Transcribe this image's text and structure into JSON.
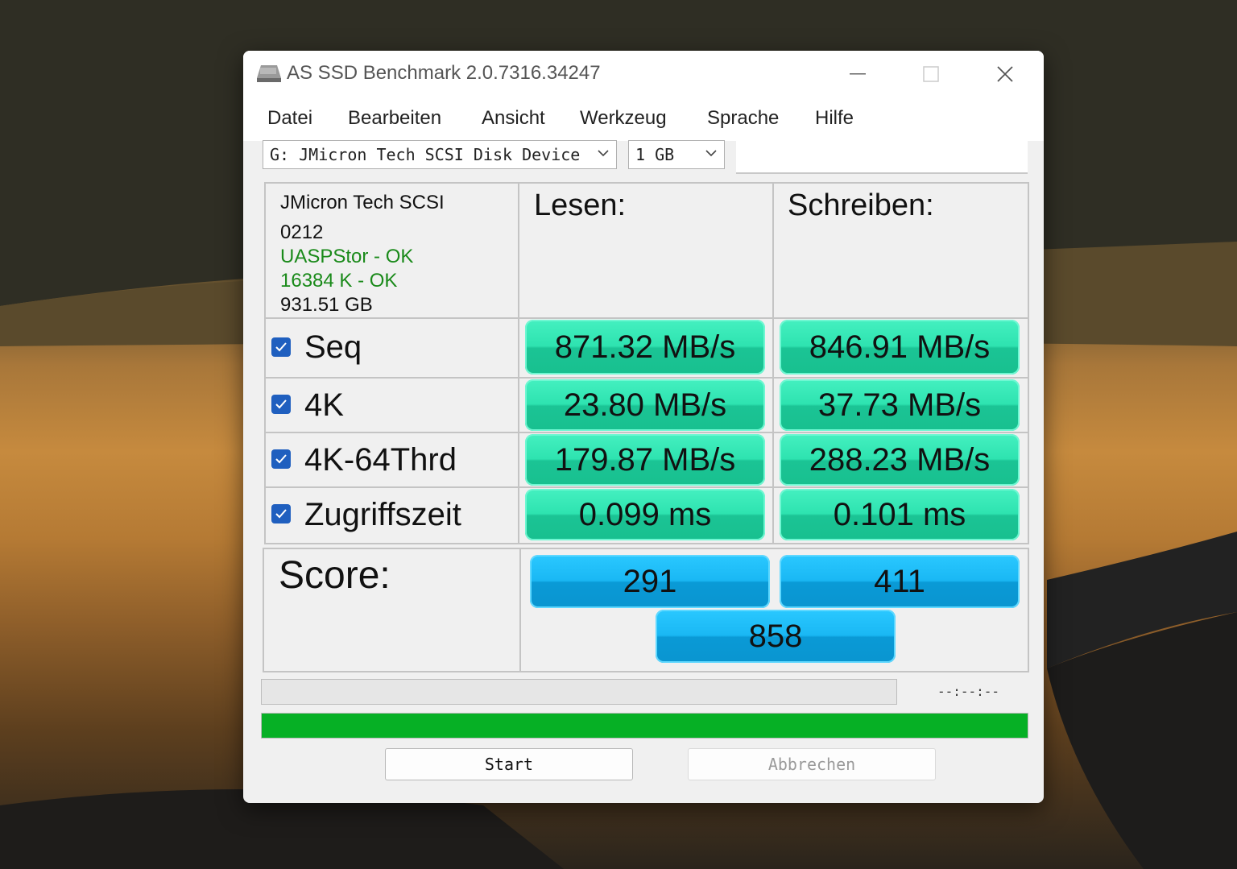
{
  "window": {
    "title": "AS SSD Benchmark 2.0.7316.34247"
  },
  "menu": [
    "Datei",
    "Bearbeiten",
    "Ansicht",
    "Werkzeug",
    "Sprache",
    "Hilfe"
  ],
  "drive_select": {
    "value": "G: JMicron Tech SCSI Disk Device"
  },
  "size_select": {
    "value": "1 GB"
  },
  "info": {
    "model": "JMicron Tech SCSI",
    "firmware": "0212",
    "driver": "UASPStor - OK",
    "alignment": "16384 K - OK",
    "capacity": "931.51 GB"
  },
  "headers": {
    "read": "Lesen:",
    "write": "Schreiben:"
  },
  "rows": [
    {
      "label": "Seq",
      "checked": true,
      "read": "871.32 MB/s",
      "write": "846.91 MB/s"
    },
    {
      "label": "4K",
      "checked": true,
      "read": "23.80 MB/s",
      "write": "37.73 MB/s"
    },
    {
      "label": "4K-64Thrd",
      "checked": true,
      "read": "179.87 MB/s",
      "write": "288.23 MB/s"
    },
    {
      "label": "Zugriffszeit",
      "checked": true,
      "read": "0.099 ms",
      "write": "0.101 ms"
    }
  ],
  "score": {
    "label": "Score:",
    "read": "291",
    "write": "411",
    "total": "858"
  },
  "progress": {
    "time": "--:--:--",
    "test_fraction": 0,
    "overall_fraction": 1.0
  },
  "buttons": {
    "start": "Start",
    "cancel": "Abbrechen"
  },
  "colors": {
    "ok_text": "#1a8a1a",
    "result_green": "#2ee3b0",
    "score_blue": "#1ab8f4",
    "progress_green": "#06b025"
  }
}
